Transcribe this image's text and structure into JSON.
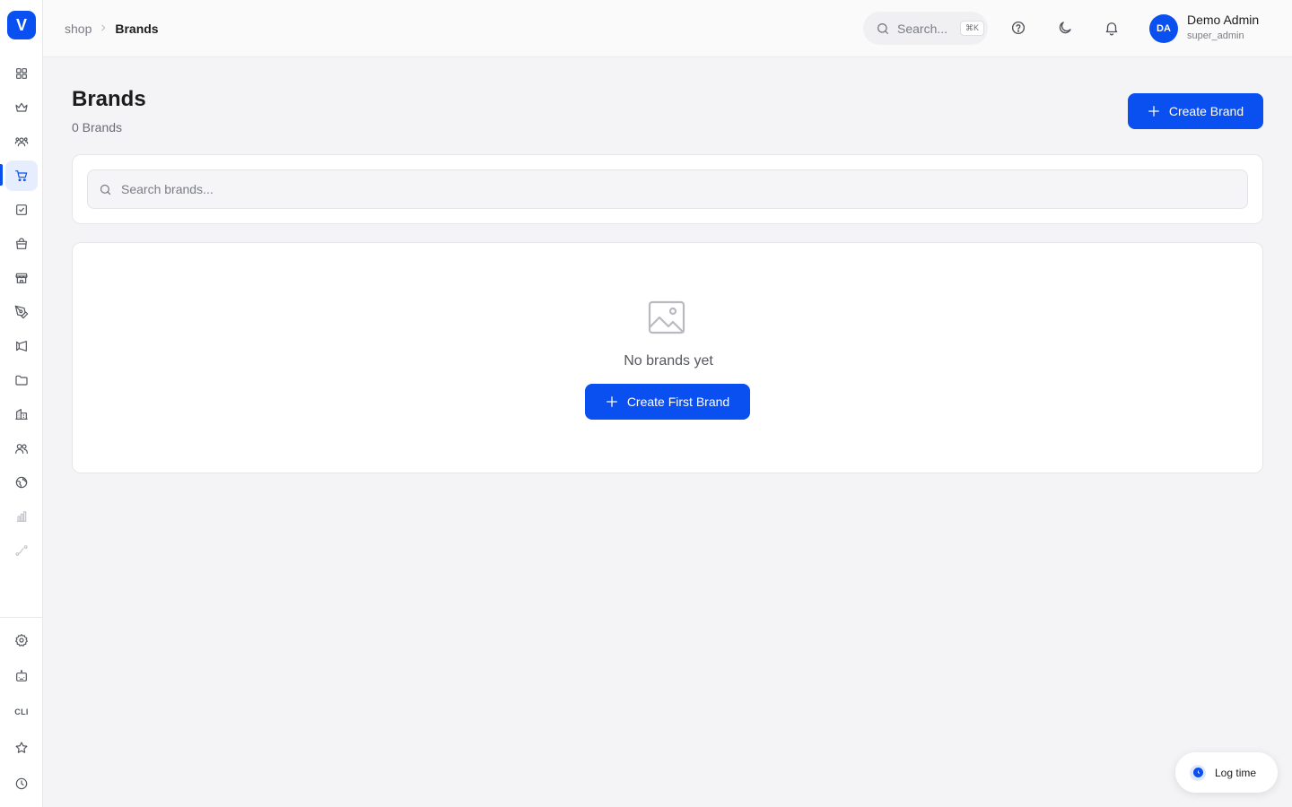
{
  "sidebar": {
    "logo": "V",
    "bottom": {
      "cli_label": "CLI"
    }
  },
  "topbar": {
    "breadcrumb": {
      "parent": "shop",
      "current": "Brands"
    },
    "search": {
      "placeholder": "Search...",
      "shortcut": "⌘K"
    },
    "user": {
      "initials": "DA",
      "name": "Demo Admin",
      "role": "super_admin"
    }
  },
  "page": {
    "title": "Brands",
    "count_text": "0 Brands",
    "create_button": "Create Brand",
    "search_placeholder": "Search brands...",
    "empty_state": {
      "message": "No brands yet",
      "button": "Create First Brand"
    }
  },
  "log_time": {
    "label": "Log time"
  },
  "colors": {
    "accent": "#0a4ff0",
    "background": "#f4f4f6",
    "surface": "#ffffff"
  }
}
